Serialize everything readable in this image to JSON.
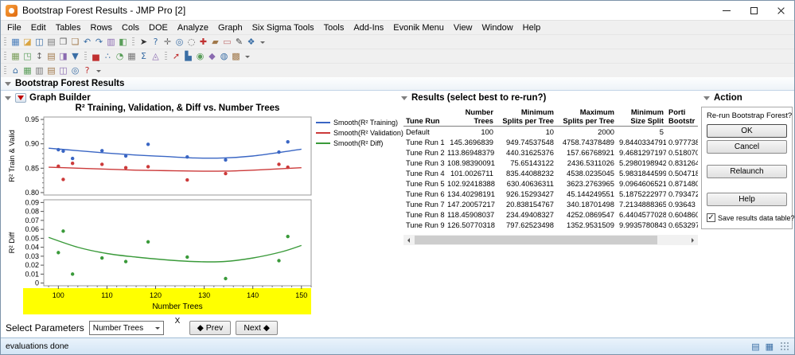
{
  "window": {
    "title": "Bootstrap Forest Results - JMP Pro [2]"
  },
  "menu_bar": {
    "items": [
      "File",
      "Edit",
      "Tables",
      "Rows",
      "Cols",
      "DOE",
      "Analyze",
      "Graph",
      "Six Sigma Tools",
      "Tools",
      "Add-Ins",
      "Evonik Menu",
      "View",
      "Window",
      "Help"
    ]
  },
  "toolbars": {
    "row1": [
      {
        "icons": [
          {
            "name": "new-data-table-icon",
            "glyph": "▦",
            "color": "#4a7ebb"
          },
          {
            "name": "open-file-icon",
            "glyph": "◪",
            "color": "#d9a441"
          },
          {
            "name": "save-icon",
            "glyph": "◫",
            "color": "#3a6ea5"
          },
          {
            "name": "print-icon",
            "glyph": "▤",
            "color": "#777777"
          },
          {
            "name": "copy-icon",
            "glyph": "❐",
            "color": "#666666"
          },
          {
            "name": "paste-icon",
            "glyph": "❏",
            "color": "#a0784a"
          },
          {
            "name": "undo-icon",
            "glyph": "↶",
            "color": "#3a6ea5"
          },
          {
            "name": "redo-icon",
            "glyph": "↷",
            "color": "#3a6ea5"
          },
          {
            "name": "journal-icon",
            "glyph": "▥",
            "color": "#8a6ab0"
          },
          {
            "name": "layout-icon",
            "glyph": "◧",
            "color": "#5a9e5a"
          }
        ]
      },
      {
        "icons": [
          {
            "name": "arrow-tool-icon",
            "glyph": "➤",
            "color": "#333333"
          },
          {
            "name": "help-tool-icon",
            "glyph": "?",
            "color": "#3a6ea5"
          },
          {
            "name": "grabber-tool-icon",
            "glyph": "✛",
            "color": "#666666"
          },
          {
            "name": "zoom-tool-icon",
            "glyph": "◎",
            "color": "#3a6ea5"
          },
          {
            "name": "lasso-tool-icon",
            "glyph": "◌",
            "color": "#555555"
          },
          {
            "name": "crosshair-tool-icon",
            "glyph": "✚",
            "color": "#c03030"
          },
          {
            "name": "brush-tool-icon",
            "glyph": "▰",
            "color": "#a0784a"
          },
          {
            "name": "eraser-tool-icon",
            "glyph": "▭",
            "color": "#c07070"
          },
          {
            "name": "annotate-tool-icon",
            "glyph": "✎",
            "color": "#444444"
          },
          {
            "name": "selection-tool-icon",
            "glyph": "❖",
            "color": "#3a6ea5"
          }
        ]
      }
    ],
    "row2": [
      {
        "icons": [
          {
            "name": "summary-icon",
            "glyph": "▦",
            "color": "#7a9e5a"
          },
          {
            "name": "subset-icon",
            "glyph": "◳",
            "color": "#5a9e5a"
          },
          {
            "name": "sort-icon",
            "glyph": "↕",
            "color": "#666666"
          },
          {
            "name": "stack-icon",
            "glyph": "▤",
            "color": "#a0784a"
          },
          {
            "name": "join-icon",
            "glyph": "◨",
            "color": "#8a6ab0"
          },
          {
            "name": "data-filter-icon",
            "glyph": "▼",
            "color": "#3a6ea5"
          }
        ]
      },
      {
        "icons": [
          {
            "name": "distribution-icon",
            "glyph": "▅",
            "color": "#c03030"
          },
          {
            "name": "fit-y-by-x-icon",
            "glyph": "∴",
            "color": "#3a6ea5"
          },
          {
            "name": "matched-pairs-icon",
            "glyph": "◔",
            "color": "#5a9e5a"
          },
          {
            "name": "tabulate-icon",
            "glyph": "▦",
            "color": "#777777"
          },
          {
            "name": "fit-model-icon",
            "glyph": "Σ",
            "color": "#3a6ea5"
          },
          {
            "name": "predictive-modeling-icon",
            "glyph": "◬",
            "color": "#8a6ab0"
          }
        ]
      },
      {
        "icons": [
          {
            "name": "graph-builder-icon",
            "glyph": "➚",
            "color": "#c03030"
          },
          {
            "name": "bar-chart-icon",
            "glyph": "▙",
            "color": "#3a6ea5"
          },
          {
            "name": "overlay-plot-icon",
            "glyph": "◉",
            "color": "#5a9e5a"
          },
          {
            "name": "scatterplot-3d-icon",
            "glyph": "◆",
            "color": "#8a6ab0"
          },
          {
            "name": "contour-plot-icon",
            "glyph": "◍",
            "color": "#3a6ea5"
          },
          {
            "name": "cell-plot-icon",
            "glyph": "▩",
            "color": "#a0784a"
          }
        ]
      }
    ],
    "row3": [
      {
        "icons": [
          {
            "name": "home-window-icon",
            "glyph": "⌂",
            "color": "#3a6ea5"
          },
          {
            "name": "data-table-window-icon",
            "glyph": "▦",
            "color": "#5a9e5a"
          },
          {
            "name": "log-window-icon",
            "glyph": "▥",
            "color": "#777777"
          },
          {
            "name": "script-editor-icon",
            "glyph": "▤",
            "color": "#a0784a"
          },
          {
            "name": "arrange-windows-icon",
            "glyph": "◫",
            "color": "#8a6ab0"
          },
          {
            "name": "search-icon",
            "glyph": "◎",
            "color": "#3a6ea5"
          },
          {
            "name": "help-icon",
            "glyph": "?",
            "color": "#c03030"
          }
        ]
      }
    ]
  },
  "report": {
    "title": "Bootstrap Forest Results"
  },
  "graph": {
    "panel_title": "Graph Builder"
  },
  "chart_data": {
    "type": "scatter",
    "title": "R² Training, Validation, & Diff vs. Number Trees",
    "x_label": "Number Trees",
    "x_drop_zone_label": "X",
    "x_range": [
      97,
      152
    ],
    "x_ticks": [
      100,
      110,
      120,
      130,
      140,
      150
    ],
    "x_axis_highlight_color": "#ffff00",
    "legend_position": "right-top",
    "legend": [
      {
        "label": "Smooth(R² Training)",
        "color": "#3a66c4"
      },
      {
        "label": "Smooth(R² Validation)",
        "color": "#cc3a3a"
      },
      {
        "label": "Smooth(R² Diff)",
        "color": "#3a9a3a"
      }
    ],
    "panels": [
      {
        "y_label": "R² Train & Valid",
        "y_range": [
          0.795,
          0.955
        ],
        "y_ticks": [
          0.8,
          0.85,
          0.9,
          0.95
        ],
        "y_tick_labels": [
          "0.80",
          "0.85",
          "0.90",
          "0.95"
        ],
        "y_minor_step": 0.01,
        "series": [
          {
            "name": "Smooth(R² Training)",
            "color": "#3a66c4",
            "points": [
              [
                100,
                0.888
              ],
              [
                101,
                0.885
              ],
              [
                102.92,
                0.87
              ],
              [
                108.98,
                0.886
              ],
              [
                113.87,
                0.875
              ],
              [
                118.46,
                0.899
              ],
              [
                126.51,
                0.873
              ],
              [
                134.4,
                0.867
              ],
              [
                145.37,
                0.883
              ],
              [
                147.2,
                0.904
              ]
            ],
            "smooth": [
              [
                98,
                0.891
              ],
              [
                104,
                0.886
              ],
              [
                110,
                0.881
              ],
              [
                116,
                0.877
              ],
              [
                122,
                0.874
              ],
              [
                128,
                0.871
              ],
              [
                134,
                0.871
              ],
              [
                140,
                0.875
              ],
              [
                146,
                0.883
              ],
              [
                150,
                0.889
              ]
            ]
          },
          {
            "name": "Smooth(R² Validation)",
            "color": "#cc3a3a",
            "points": [
              [
                100,
                0.854
              ],
              [
                101,
                0.827
              ],
              [
                102.92,
                0.86
              ],
              [
                108.98,
                0.858
              ],
              [
                113.87,
                0.851
              ],
              [
                118.46,
                0.853
              ],
              [
                126.51,
                0.826
              ],
              [
                134.4,
                0.839
              ],
              [
                145.37,
                0.858
              ],
              [
                147.2,
                0.852
              ]
            ],
            "smooth": [
              [
                98,
                0.852
              ],
              [
                104,
                0.85
              ],
              [
                110,
                0.848
              ],
              [
                116,
                0.846
              ],
              [
                122,
                0.845
              ],
              [
                128,
                0.844
              ],
              [
                134,
                0.844
              ],
              [
                140,
                0.846
              ],
              [
                146,
                0.849
              ],
              [
                150,
                0.851
              ]
            ]
          }
        ]
      },
      {
        "y_label": "R² Diff",
        "y_range": [
          -0.003,
          0.093
        ],
        "y_ticks": [
          0,
          0.01,
          0.02,
          0.03,
          0.04,
          0.05,
          0.06,
          0.07,
          0.08,
          0.09
        ],
        "y_tick_labels": [
          "0",
          "0.01",
          "0.02",
          "0.03",
          "0.04",
          "0.05",
          "0.06",
          "0.07",
          "0.08",
          "0.09"
        ],
        "series": [
          {
            "name": "Smooth(R² Diff)",
            "color": "#3a9a3a",
            "points": [
              [
                100,
                0.034
              ],
              [
                101,
                0.058
              ],
              [
                102.92,
                0.01
              ],
              [
                108.98,
                0.028
              ],
              [
                113.87,
                0.024
              ],
              [
                118.46,
                0.046
              ],
              [
                126.51,
                0.029
              ],
              [
                134.4,
                0.005
              ],
              [
                145.37,
                0.025
              ],
              [
                147.2,
                0.052
              ]
            ],
            "smooth": [
              [
                98,
                0.051
              ],
              [
                104,
                0.04
              ],
              [
                110,
                0.033
              ],
              [
                116,
                0.029
              ],
              [
                122,
                0.026
              ],
              [
                128,
                0.024
              ],
              [
                134,
                0.024
              ],
              [
                140,
                0.028
              ],
              [
                146,
                0.035
              ],
              [
                150,
                0.042
              ]
            ]
          }
        ]
      }
    ]
  },
  "results": {
    "title": "Results (select best to re-run?)",
    "columns": [
      {
        "line1": "",
        "line2": "Tune Run",
        "align": "left"
      },
      {
        "line1": "Number",
        "line2": "Trees",
        "align": "right"
      },
      {
        "line1": "Minimum",
        "line2": "Splits per Tree",
        "align": "right"
      },
      {
        "line1": "Maximum",
        "line2": "Splits per Tree",
        "align": "right"
      },
      {
        "line1": "Minimum",
        "line2": "Size Split",
        "align": "right"
      },
      {
        "line1": "Porti",
        "line2": "Bootstr",
        "align": "left"
      }
    ],
    "rows": [
      {
        "label": "Default",
        "values": [
          "100",
          "10",
          "2000",
          "5",
          ""
        ]
      },
      {
        "label": "Tune Run 1",
        "values": [
          "145.3696839",
          "949.74537548",
          "4758.74378489",
          "9.8440334791",
          "0.977738"
        ]
      },
      {
        "label": "Tune Run 2",
        "values": [
          "113.86948379",
          "440.31625376",
          "157.66768921",
          "9.4681297197",
          "0.518070"
        ]
      },
      {
        "label": "Tune Run 3",
        "values": [
          "108.98390091",
          "75.65143122",
          "2436.5311026",
          "5.2980198942",
          "0.831264"
        ]
      },
      {
        "label": "Tune Run 4",
        "values": [
          "101.0026711",
          "835.44088232",
          "4538.0235045",
          "5.9831844599",
          "0.504718"
        ]
      },
      {
        "label": "Tune Run 5",
        "values": [
          "102.92418388",
          "630.40636311",
          "3623.2763965",
          "9.0964606521",
          "0.871480"
        ]
      },
      {
        "label": "Tune Run 6",
        "values": [
          "134.40298191",
          "926.15293427",
          "45.144249551",
          "5.1875222977",
          "0.793472"
        ]
      },
      {
        "label": "Tune Run 7",
        "values": [
          "147.20057217",
          "20.838154767",
          "340.18701498",
          "7.2134888365",
          "0.93643"
        ]
      },
      {
        "label": "Tune Run 8",
        "values": [
          "118.45908037",
          "234.49408327",
          "4252.0869547",
          "6.4404577028",
          "0.604860"
        ]
      },
      {
        "label": "Tune Run 9",
        "values": [
          "126.50770318",
          "797.62523498",
          "1352.9531509",
          "9.9935780843",
          "0.653297"
        ]
      }
    ]
  },
  "action": {
    "title": "Action",
    "prompt": "Re-run Bootstrap Forest?",
    "buttons": {
      "ok": "OK",
      "cancel": "Cancel",
      "relaunch": "Relaunch",
      "help": "Help"
    },
    "save_checkbox_label": "Save results data table?",
    "save_checked": true
  },
  "footer": {
    "label": "Select Parameters",
    "dropdown_value": "Number Trees",
    "prev_label": "◆ Prev",
    "next_label": "Next ◆"
  },
  "status_bar": {
    "text": "evaluations done",
    "icons": [
      {
        "name": "status-grid-icon",
        "glyph": "▤",
        "color": "#3a6ea5"
      },
      {
        "name": "status-table-icon",
        "glyph": "▦",
        "color": "#3a6ea5"
      }
    ]
  }
}
